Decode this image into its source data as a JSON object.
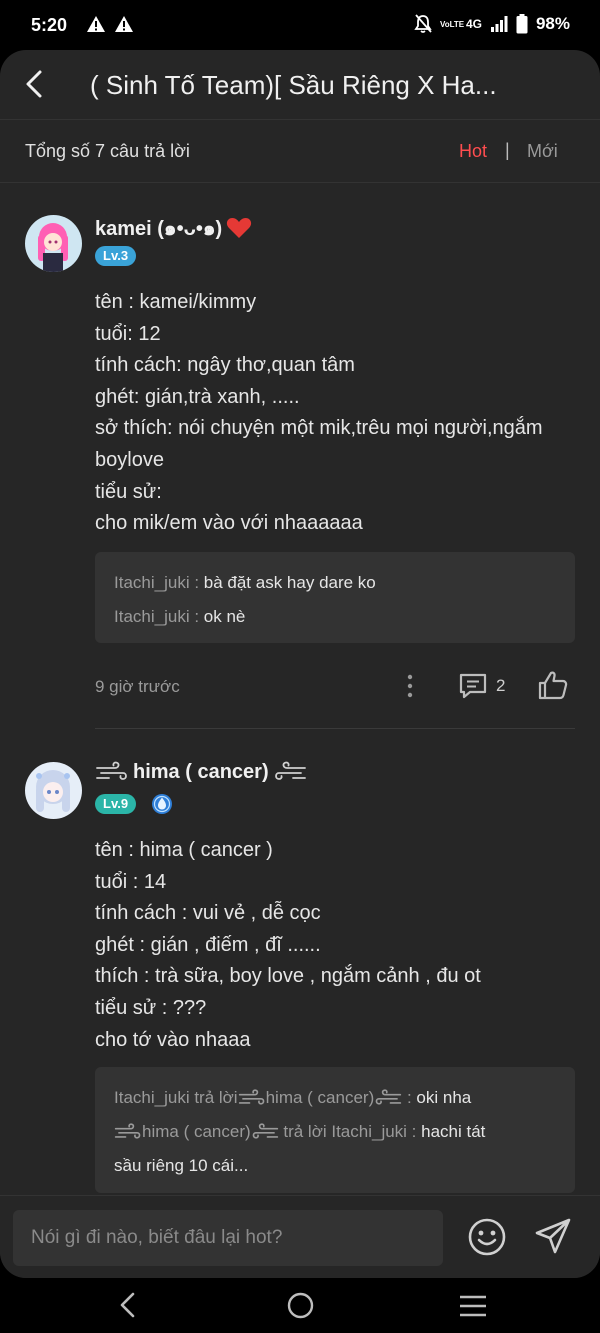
{
  "status_bar": {
    "time": "5:20",
    "volte": "VoLTE",
    "network": "4G",
    "battery": "98%"
  },
  "header": {
    "title": "( Sinh Tố Team)[ Sầu Riêng X Ha..."
  },
  "subheader": {
    "answer_count": "Tổng số 7 câu trả lời",
    "sort_hot": "Hot",
    "sort_separator": "|",
    "sort_new": "Mới"
  },
  "comments": [
    {
      "username": "kamei (๑•ᴗ•๑)",
      "level": "Lv.3",
      "lines": [
        "tên : kamei/kimmy",
        "tuổi: 12",
        "tính cách: ngây thơ,quan tâm",
        "ghét: gián,trà xanh, .....",
        "sở thích: nói chuyện một mik,trêu mọi người,ngắm",
        "boylove",
        "tiểu sử:",
        "cho mik/em vào với nhaaaaaa"
      ],
      "replies": [
        {
          "who": "Itachi_juki : ",
          "text": "bà đặt ask hay dare ko"
        },
        {
          "who": "Itachi_juki : ",
          "text": "ok nè"
        }
      ],
      "time": "9 giờ trước",
      "reply_count": "2"
    },
    {
      "username": "hima ( cancer)",
      "level": "Lv.9",
      "lines": [
        "tên : hima ( cancer )",
        "tuổi : 14",
        "tính cách : vui vẻ , dễ cọc",
        "ghét : gián , điếm , đĩ ......",
        "thích : trà sữa, boy love  , ngắm cảnh , đu ot",
        "tiểu sử : ???",
        "cho tớ vào nhaaa"
      ],
      "replies": [
        {
          "who_a": "Itachi_juki trả lời ",
          "name_b": " hima ( cancer) ",
          "sep": " : ",
          "text": "oki nha"
        },
        {
          "name_a": " hima ( cancer) ",
          "who_b": " trả lời Itachi_juki : ",
          "text": "hachi tát"
        },
        {
          "text": "sầu riêng 10 cái..."
        }
      ]
    }
  ],
  "composer": {
    "placeholder": "Nói gì đi nào, biết đâu lại hot?"
  },
  "colors": {
    "background": "#262626",
    "accent_hot": "#ff4d4f",
    "level_badge_lv3": "#3aa3d8",
    "level_badge_lv9": "#2bb5a8",
    "reply_box": "#333333"
  },
  "icons": [
    "warning-icon",
    "mute-icon",
    "signal-icon",
    "battery-icon",
    "back-icon",
    "more-icon",
    "comment-icon",
    "like-icon",
    "heart-icon",
    "wind-icon",
    "vip-icon",
    "emoji-icon",
    "send-icon",
    "nav-back-icon",
    "nav-home-icon",
    "nav-recent-icon"
  ]
}
